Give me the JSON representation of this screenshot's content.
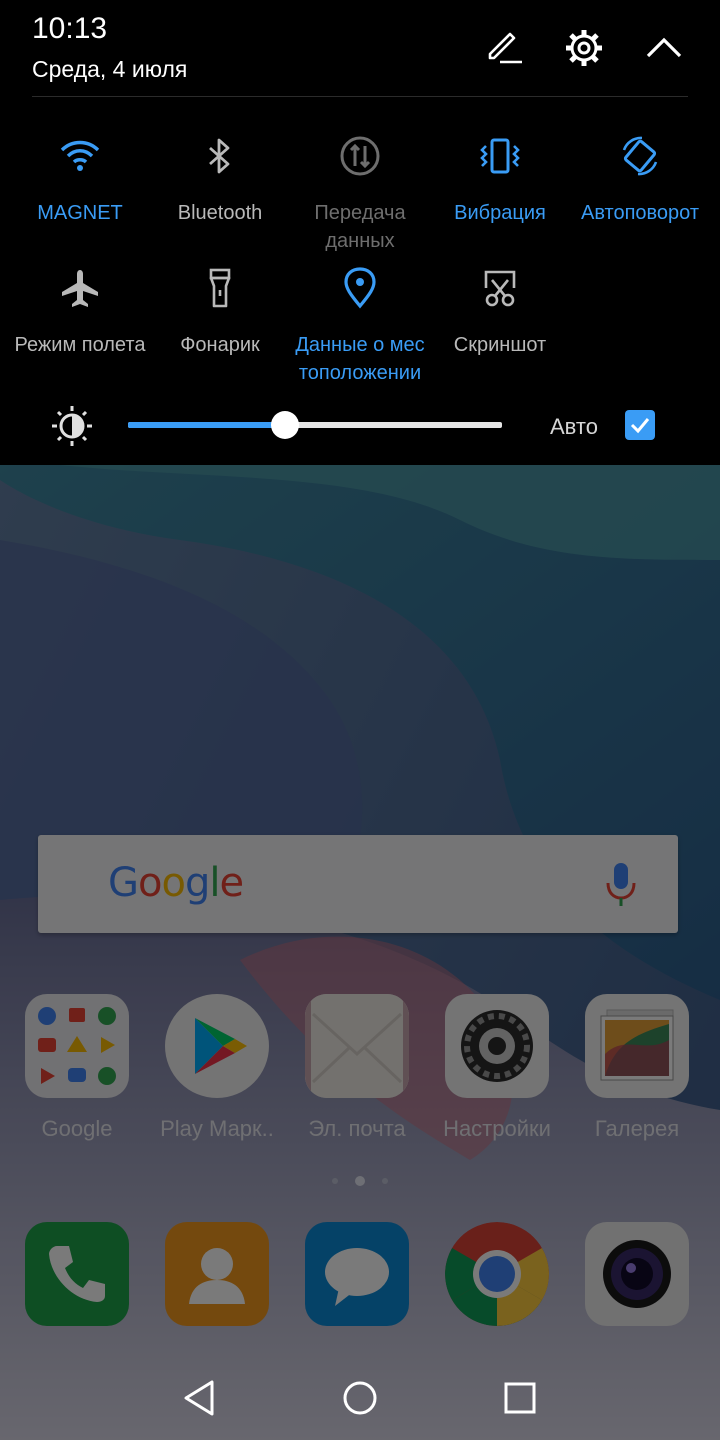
{
  "shade": {
    "time": "10:13",
    "date": "Среда, 4 июля",
    "header_icons": [
      "edit-icon",
      "settings-icon",
      "collapse-icon"
    ],
    "tiles": [
      {
        "label": "MAGNET",
        "icon": "wifi-icon",
        "state": "on"
      },
      {
        "label": "Bluetooth",
        "icon": "bluetooth-icon",
        "state": "off"
      },
      {
        "label": "Передача данных",
        "icon": "mobile-data-icon",
        "state": "disabled"
      },
      {
        "label": "Вибрация",
        "icon": "vibration-icon",
        "state": "on"
      },
      {
        "label": "Автоповорот",
        "icon": "auto-rotate-icon",
        "state": "on"
      },
      {
        "label": "Режим полета",
        "icon": "airplane-icon",
        "state": "off"
      },
      {
        "label": "Фонарик",
        "icon": "flashlight-icon",
        "state": "off"
      },
      {
        "label": "Данные о мес тоположении",
        "icon": "location-icon",
        "state": "on"
      },
      {
        "label": "Скриншот",
        "icon": "screenshot-icon",
        "state": "off"
      }
    ],
    "brightness": {
      "level": 0.42,
      "auto_label": "Авто",
      "auto_checked": true
    },
    "colors": {
      "accent": "#3a9cf5",
      "background": "#000000"
    }
  },
  "home": {
    "search": {
      "logo": "Google",
      "icon": "mic-icon"
    },
    "apps": [
      {
        "label": "Google",
        "icon": "google-folder-icon"
      },
      {
        "label": "Play Марк..",
        "icon": "play-store-icon"
      },
      {
        "label": "Эл. почта",
        "icon": "email-icon"
      },
      {
        "label": "Настройки",
        "icon": "settings-app-icon"
      },
      {
        "label": "Галерея",
        "icon": "gallery-icon"
      }
    ],
    "dock": [
      {
        "icon": "phone-icon"
      },
      {
        "icon": "contacts-icon"
      },
      {
        "icon": "messages-icon"
      },
      {
        "icon": "chrome-icon"
      },
      {
        "icon": "camera-icon"
      }
    ],
    "page_count": 3,
    "current_page": 2
  },
  "navbar": {
    "icons": [
      "back-icon",
      "home-icon",
      "recents-icon"
    ]
  }
}
